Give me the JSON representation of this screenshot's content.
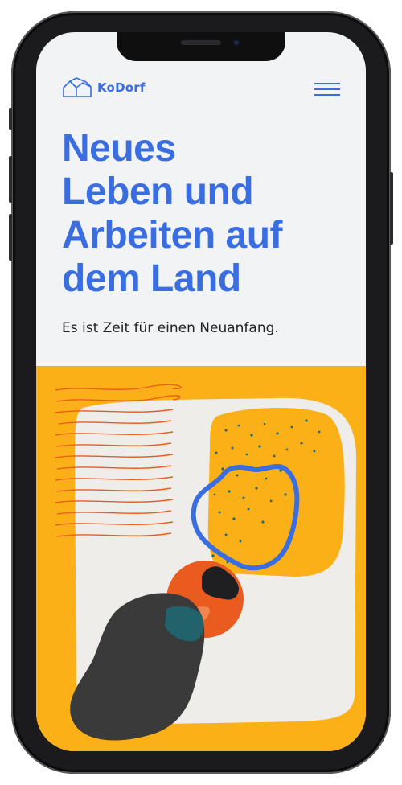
{
  "brand": {
    "name": "KoDorf"
  },
  "hero": {
    "headline_lines": [
      "Neues",
      "Leben und",
      "Arbeiten auf",
      "dem Land"
    ],
    "subline": "Es ist Zeit für einen Neuanfang."
  },
  "icons": {
    "logo": "house-outline-icon",
    "menu": "hamburger-menu-icon"
  },
  "colors": {
    "accent": "#3a6ee0",
    "yellow": "#fbb017",
    "orange": "#ea5b1f",
    "dark": "#3a3a3a",
    "teal": "#1f6a74",
    "paper": "#eeede9"
  }
}
